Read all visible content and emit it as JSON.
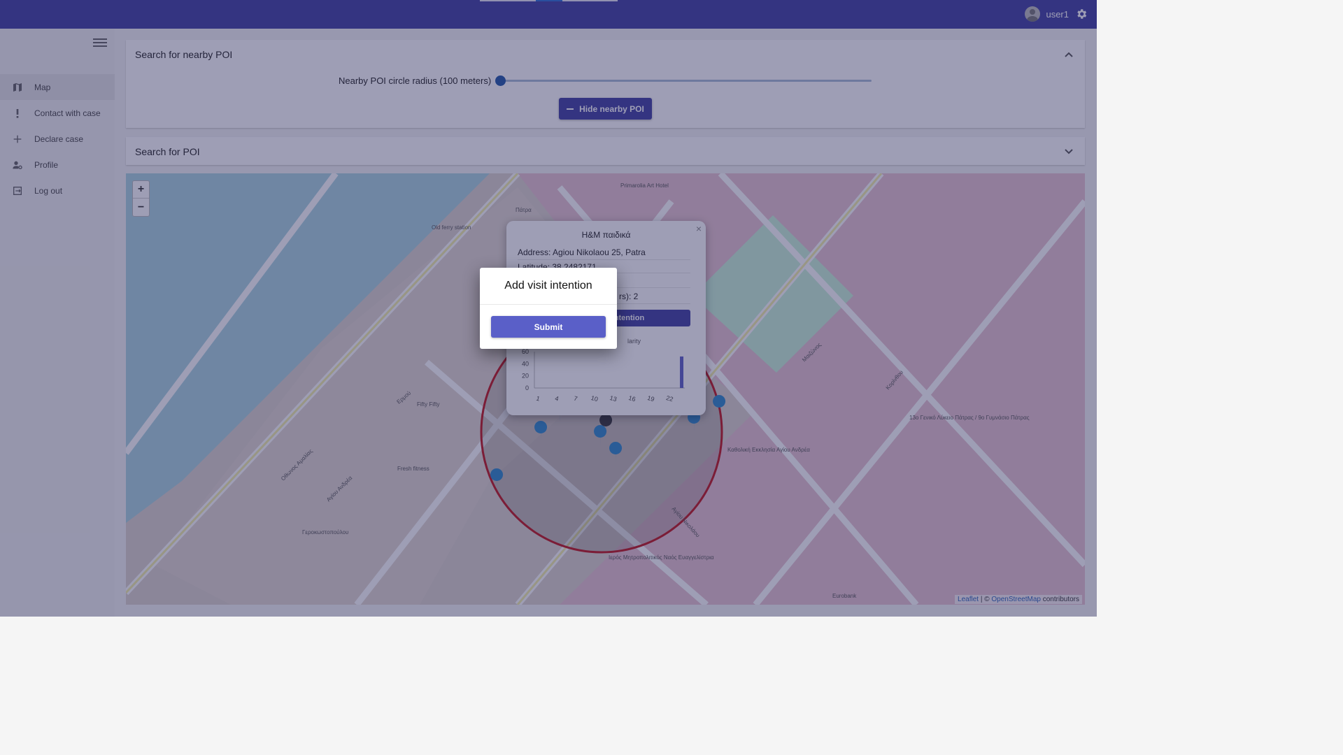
{
  "appbar": {
    "username": "user1"
  },
  "sidebar": {
    "items": [
      {
        "label": "Map",
        "icon": "map-icon"
      },
      {
        "label": "Contact with case",
        "icon": "exclamation-icon"
      },
      {
        "label": "Declare case",
        "icon": "plus-icon"
      },
      {
        "label": "Profile",
        "icon": "user-settings-icon"
      },
      {
        "label": "Log out",
        "icon": "logout-icon"
      }
    ]
  },
  "nearby_panel": {
    "title": "Search for nearby POI",
    "slider_label": "Nearby POI circle radius (100 meters)",
    "slider_value": 0,
    "button_label": "Hide nearby POI"
  },
  "search_panel": {
    "title": "Search for POI"
  },
  "map": {
    "zoom_in": "+",
    "zoom_out": "−",
    "attribution": {
      "leaflet": "Leaflet",
      "sep": "| ©",
      "osm": "OpenStreetMap",
      "tail": "contributors"
    },
    "labels": {
      "patra": "Πάτρα",
      "old_ferry": "Old ferry station",
      "primarolia": "Primarolia Art Hotel",
      "ermou": "Ερμού",
      "agiou_andrea": "Αγίου Ανδρέα",
      "othonos": "Οθωνος Αμαλίας",
      "korinthou": "Κορίνθου",
      "maizonos": "Μαιζώνος",
      "lyceum": "13ο Γενικό Λύκειο Πάτρας / 9ο Γυμνάσιο Πάτρας",
      "church": "Καθολική Εκκλησία Αγίου Ανδρέα",
      "metropolitan": "Ιερός Μητροπολιτικός Ναός Ευαγγελίστρια",
      "fifty": "Fifty Fifty",
      "fresh": "Fresh fitness",
      "eurobank": "Eurobank",
      "agiou_nikolaou": "Αγίου Νικολάου",
      "gerokostopoulou": "Γεροκωστοπούλου"
    }
  },
  "popup": {
    "title": "H&M παιδικά",
    "close": "×",
    "address": "Address: Agiou Nikolaou 25, Patra",
    "latitude": "Latitude: 38.2482171",
    "estimate": "rs): 2",
    "button_fragment": "ntention",
    "chart_fragment": "larity"
  },
  "chart_data": {
    "type": "bar",
    "title": "",
    "x": [
      1,
      2,
      3,
      4,
      5,
      6,
      7,
      8,
      9,
      10,
      11,
      12,
      13,
      14,
      15,
      16,
      17,
      18,
      19,
      20,
      21,
      22,
      23,
      24
    ],
    "x_tick_labels": [
      "1",
      "4",
      "7",
      "10",
      "13",
      "16",
      "19",
      "22"
    ],
    "values": [
      0,
      0,
      0,
      0,
      0,
      0,
      0,
      0,
      0,
      0,
      0,
      0,
      0,
      0,
      0,
      0,
      0,
      0,
      0,
      0,
      0,
      0,
      0,
      52
    ],
    "y_tick_labels": [
      "0",
      "20",
      "40",
      "60"
    ],
    "ylim": [
      0,
      60
    ],
    "bar_color": "#5b5fc7"
  },
  "dialog": {
    "title": "Add visit intention",
    "submit_label": "Submit"
  }
}
